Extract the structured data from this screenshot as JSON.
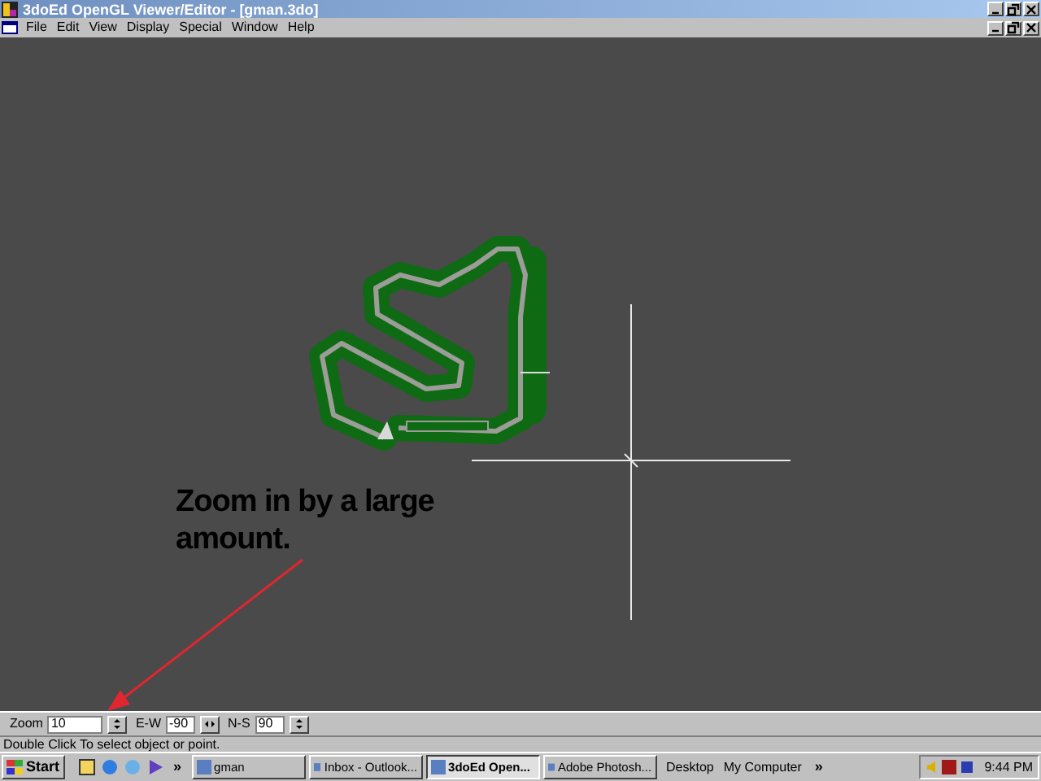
{
  "window": {
    "title": "3doEd OpenGL Viewer/Editor - [gman.3do]"
  },
  "menu": [
    "File",
    "Edit",
    "View",
    "Display",
    "Special",
    "Window",
    "Help"
  ],
  "viewport": {
    "annotation": "Zoom in by a large amount."
  },
  "toolbar": {
    "fields": [
      {
        "label": "Zoom",
        "value": "10",
        "kind": "updown"
      },
      {
        "label": "E-W",
        "value": "-90",
        "kind": "leftright"
      },
      {
        "label": "N-S",
        "value": "90",
        "kind": "updown"
      }
    ]
  },
  "status_bar": "Double Click To select object or point.",
  "taskbar": {
    "start": "Start",
    "chevron": "»",
    "buttons": [
      {
        "label": "gman",
        "selected": false
      },
      {
        "label": "Inbox - Outlook...",
        "selected": false
      },
      {
        "label": "3doEd Open...",
        "selected": true
      },
      {
        "label": "Adobe Photosh...",
        "selected": false
      }
    ],
    "toolbars": [
      "Desktop",
      "My Computer"
    ],
    "tray_chevron": "»",
    "clock": "9:44 PM"
  }
}
